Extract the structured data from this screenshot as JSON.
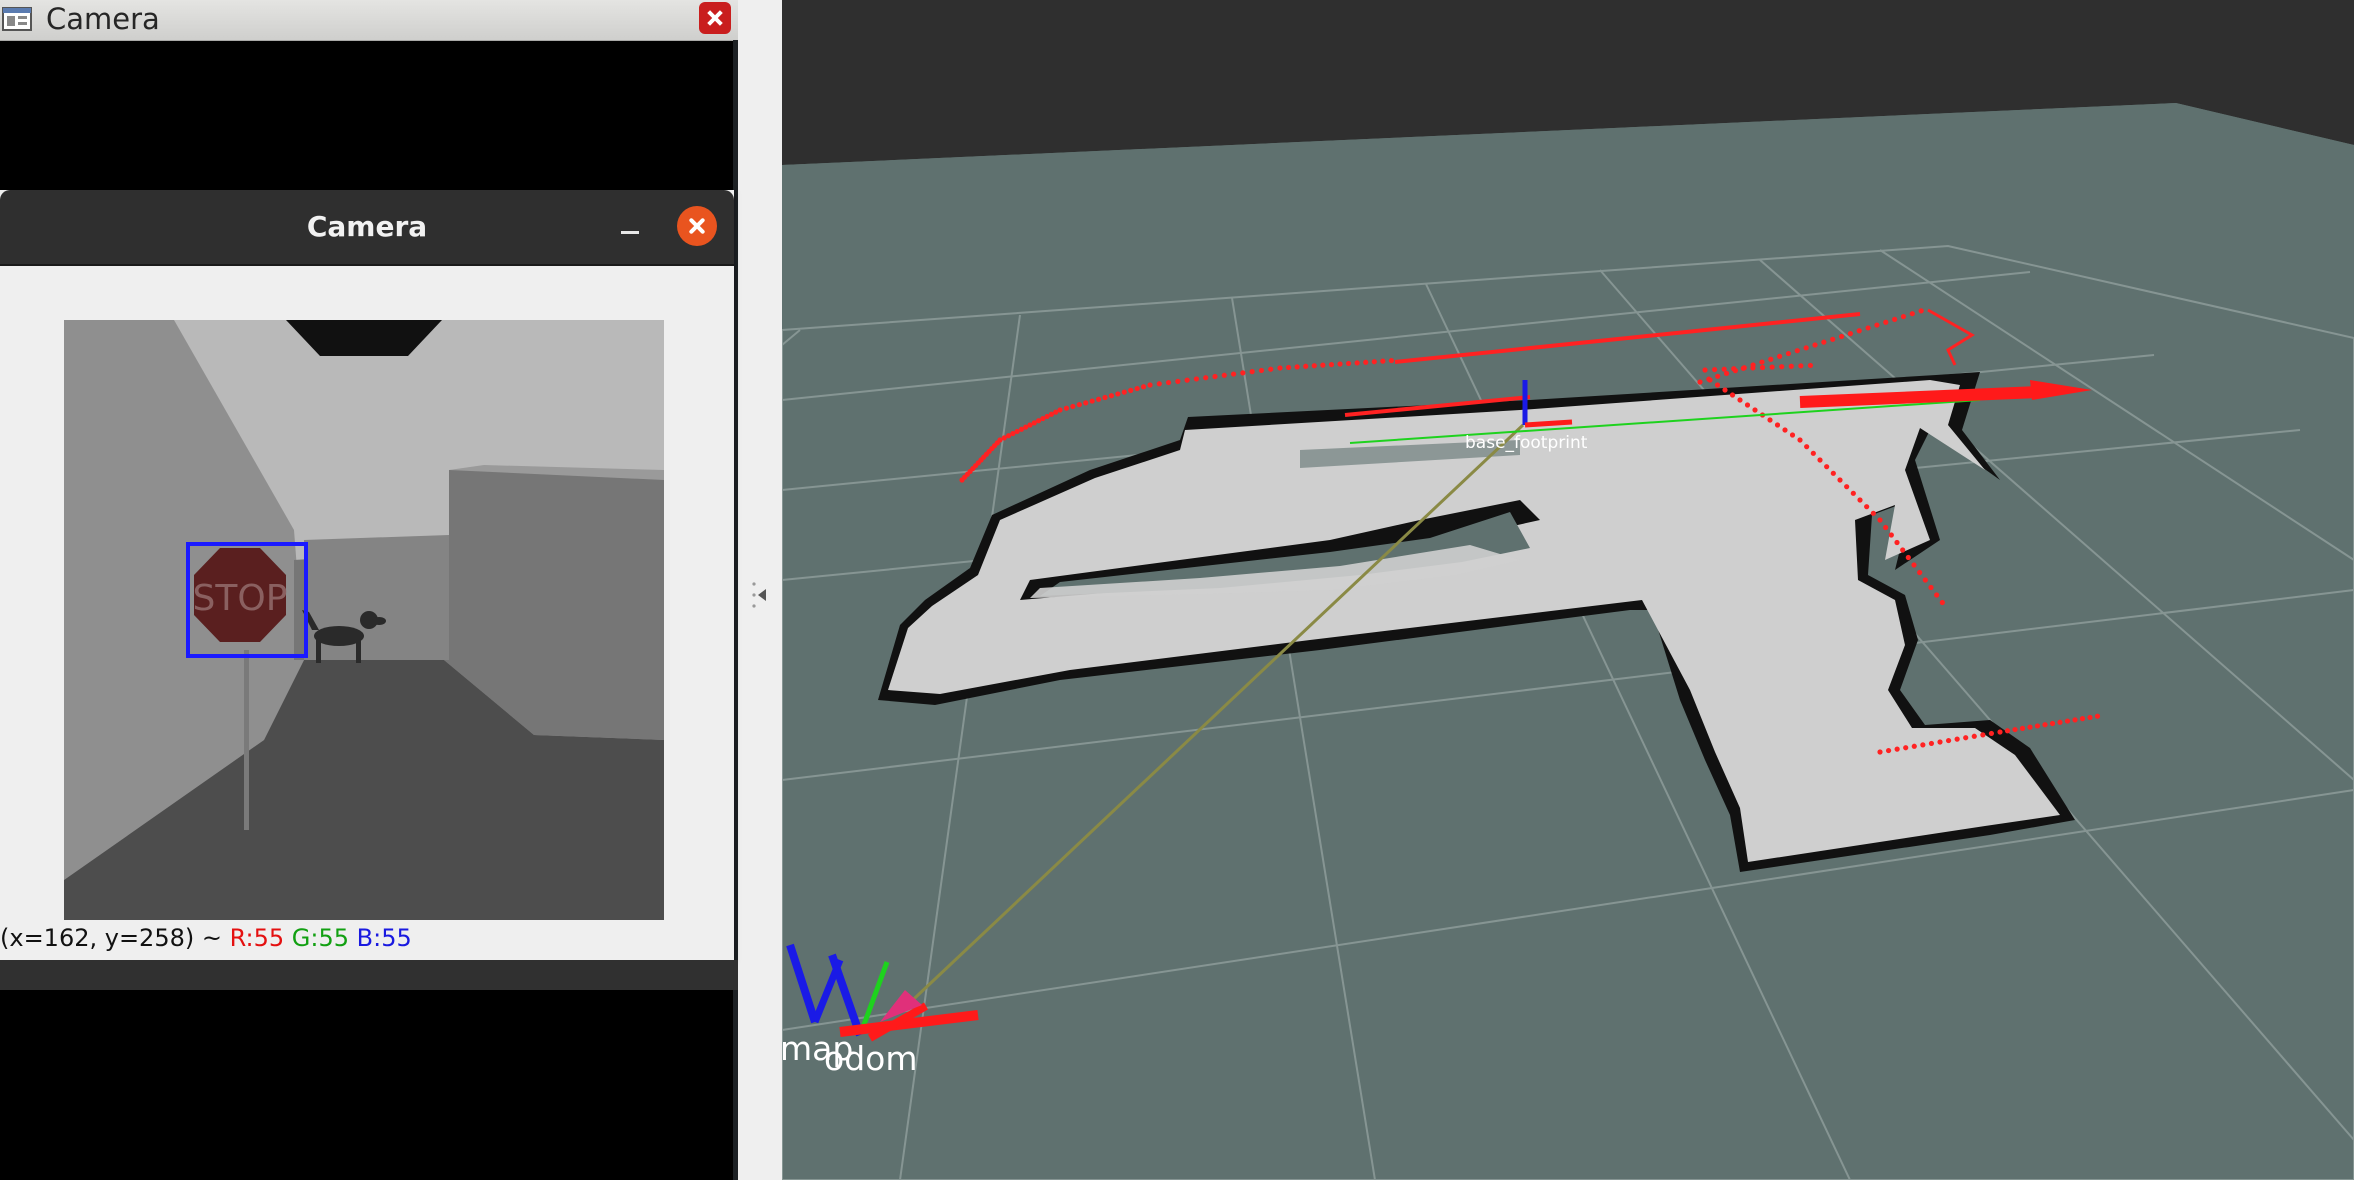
{
  "back_window": {
    "title": "Camera",
    "app_icon": "window-app-icon",
    "close_icon": "close-icon"
  },
  "front_window": {
    "title": "Camera",
    "minimize_icon": "minimize-icon",
    "close_icon": "close-icon",
    "stop_sign_text": "STOP",
    "pixel_readout": {
      "coords": "(x=162, y=258) ~ ",
      "r": "R:55",
      "g": "G:55",
      "b": "B:55"
    }
  },
  "splitter": {
    "handle_icon": "collapse-left-icon"
  },
  "viewport": {
    "frame_labels": {
      "base_footprint": "base_footprint",
      "map": "map",
      "odom": "odom"
    },
    "background_color": "#5f716f",
    "map_free_color": "#cfcfcf",
    "map_wall_color": "#111111",
    "laser_color": "#ff2222",
    "x_axis_color": "#ff1a1a",
    "y_axis_color": "#1ed21e",
    "z_axis_color": "#1a1ae6"
  }
}
